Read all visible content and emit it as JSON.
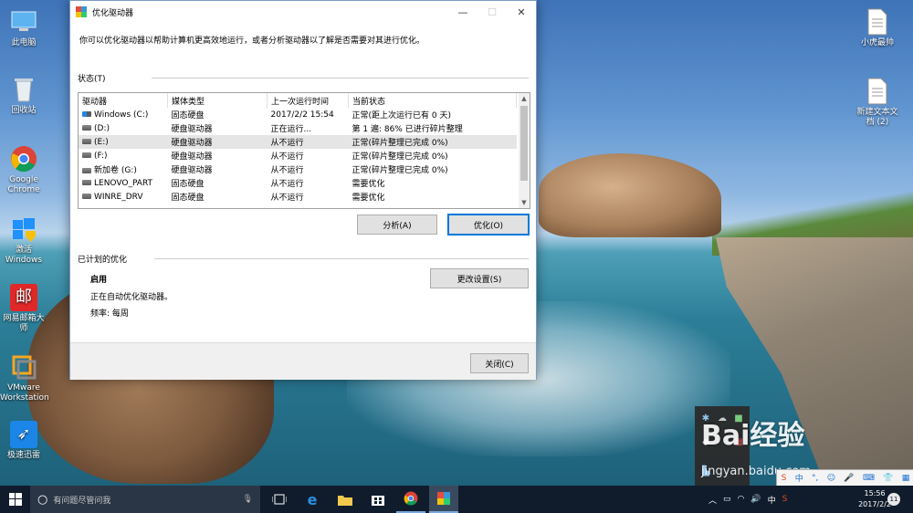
{
  "desktop": {
    "left_icons": [
      {
        "label": "此电脑",
        "icon": "computer-icon"
      },
      {
        "label": "回收站",
        "icon": "recycle-bin-icon"
      },
      {
        "label": "Google Chrome",
        "icon": "chrome-icon"
      },
      {
        "label": "激活 Windows",
        "icon": "windows-shield-icon"
      },
      {
        "label": "网易邮箱大师",
        "icon": "netease-mail-icon"
      },
      {
        "label": "VMware Workstation",
        "icon": "vmware-icon"
      },
      {
        "label": "极速迅雷",
        "icon": "thunder-icon"
      }
    ],
    "right_icons": [
      {
        "label": "小虎最帅",
        "icon": "text-file-icon"
      },
      {
        "label": "新建文本文档 (2)",
        "icon": "text-file-icon"
      }
    ]
  },
  "dialog": {
    "title": "优化驱动器",
    "intro": "你可以优化驱动器以帮助计算机更高效地运行，或者分析驱动器以了解是否需要对其进行优化。",
    "status_label": "状态(T)",
    "columns": [
      "驱动器",
      "媒体类型",
      "上一次运行时间",
      "当前状态"
    ],
    "rows": [
      {
        "drive": "Windows (C:)",
        "media": "固态硬盘",
        "last_run": "2017/2/2 15:54",
        "status": "正常(距上次运行已有 0 天)"
      },
      {
        "drive": "(D:)",
        "media": "硬盘驱动器",
        "last_run": "正在运行...",
        "status": "第 1 遍: 86% 已进行碎片整理"
      },
      {
        "drive": "(E:)",
        "media": "硬盘驱动器",
        "last_run": "从不运行",
        "status": "正常(碎片整理已完成 0%)"
      },
      {
        "drive": "(F:)",
        "media": "硬盘驱动器",
        "last_run": "从不运行",
        "status": "正常(碎片整理已完成 0%)"
      },
      {
        "drive": "新加卷 (G:)",
        "media": "硬盘驱动器",
        "last_run": "从不运行",
        "status": "正常(碎片整理已完成 0%)"
      },
      {
        "drive": "LENOVO_PART",
        "media": "固态硬盘",
        "last_run": "从不运行",
        "status": "需要优化"
      },
      {
        "drive": "WINRE_DRV",
        "media": "固态硬盘",
        "last_run": "从不运行",
        "status": "需要优化"
      }
    ],
    "analyze_button": "分析(A)",
    "optimize_button": "优化(O)",
    "scheduled_label": "已计划的优化",
    "enabled_label": "启用",
    "auto_text": "正在自动优化驱动器。",
    "frequency_text": "频率: 每周",
    "change_settings_button": "更改设置(S)",
    "close_button": "关闭(C)"
  },
  "watermark": {
    "brand": "Bai经验",
    "url": "jingyan.baidu.com"
  },
  "taskbar": {
    "search_placeholder": "有问题尽管问我",
    "time": "15:56",
    "date": "2017/2/2",
    "ime": "中",
    "notification_count": "11",
    "pinned_icons": [
      "task-view-icon",
      "edge-icon",
      "file-explorer-icon",
      "store-icon",
      "chrome-icon",
      "paint-icon"
    ]
  }
}
